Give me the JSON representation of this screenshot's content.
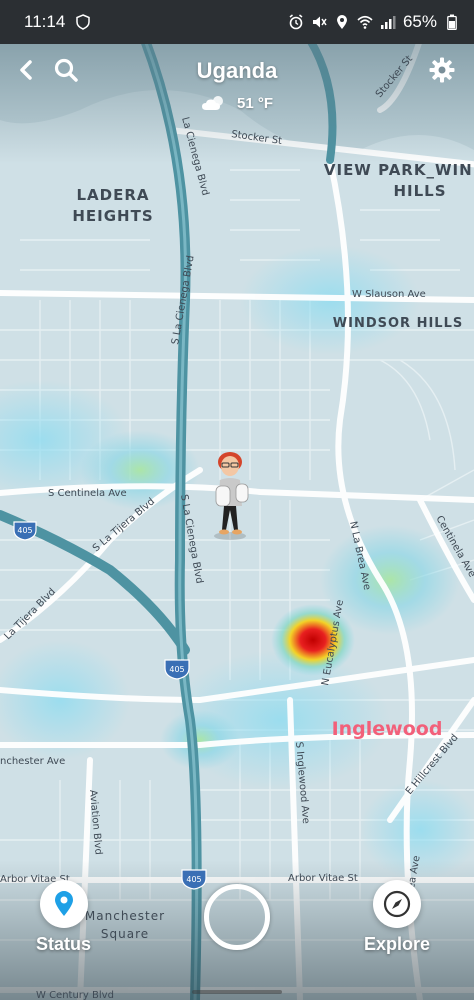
{
  "status_bar": {
    "time": "11:14",
    "battery": "65%",
    "icons": [
      "shield-icon",
      "alarm-icon",
      "mute-icon",
      "location-icon",
      "wifi-icon",
      "signal-icon",
      "battery-icon"
    ]
  },
  "header": {
    "location": "Uganda",
    "temperature": "51 °F",
    "weather_icon": "partly-cloudy-icon",
    "icons": [
      "back-chevron-icon",
      "search-icon",
      "settings-gear-icon"
    ]
  },
  "map": {
    "areas": {
      "ladera_heights_1": "LADERA",
      "ladera_heights_2": "HEIGHTS",
      "view_park_1": "VIEW PARK_WIND",
      "view_park_2": "HILLS",
      "windsor_hills": "WINDSOR HILLS",
      "inglewood": "Inglewood",
      "manchester_square_1": "Manchester",
      "manchester_square_2": "Square"
    },
    "streets": {
      "la_cienega_top": "La Cienega Blvd",
      "s_la_cienega_1": "S La Cienega Blvd",
      "s_la_cienega_2": "S La Cienega Blvd",
      "stocker_1": "Stocker St",
      "stocker_2": "Stocker St",
      "w_slauson": "W Slauson Ave",
      "s_centinela": "S Centinela Ave",
      "s_la_tijera": "S La Tijera Blvd",
      "la_tijera": "La Tijera Blvd",
      "n_la_brea": "N La Brea Ave",
      "centinela": "Centinela Ave",
      "n_eucalyptus": "N Eucalyptus Ave",
      "manchester": "nchester Ave",
      "s_inglewood": "S Inglewood Ave",
      "e_hillcrest": "E Hillcrest Blvd",
      "aviation": "Aviation Blvd",
      "arbor_vitae_1": "Arbor Vitae St",
      "arbor_vitae_2": "Arbor Vitae St",
      "la_brea_bottom": "Brea Ave",
      "w_century": "W Century Blvd"
    },
    "shields": [
      "405",
      "405",
      "405"
    ]
  },
  "bottom_bar": {
    "status_label": "Status",
    "explore_label": "Explore",
    "status_icon": "location-pin-icon",
    "explore_icon": "compass-icon",
    "capture_icon": "camera-capture-ring"
  },
  "colors": {
    "map_base": "#cfe0e6",
    "road": "#ffffff",
    "freeway": "#4e93a2",
    "heat_hot": "#e21d1d",
    "inglewood_label": "#f2607a",
    "status_bar_bg": "#2b2f33"
  }
}
